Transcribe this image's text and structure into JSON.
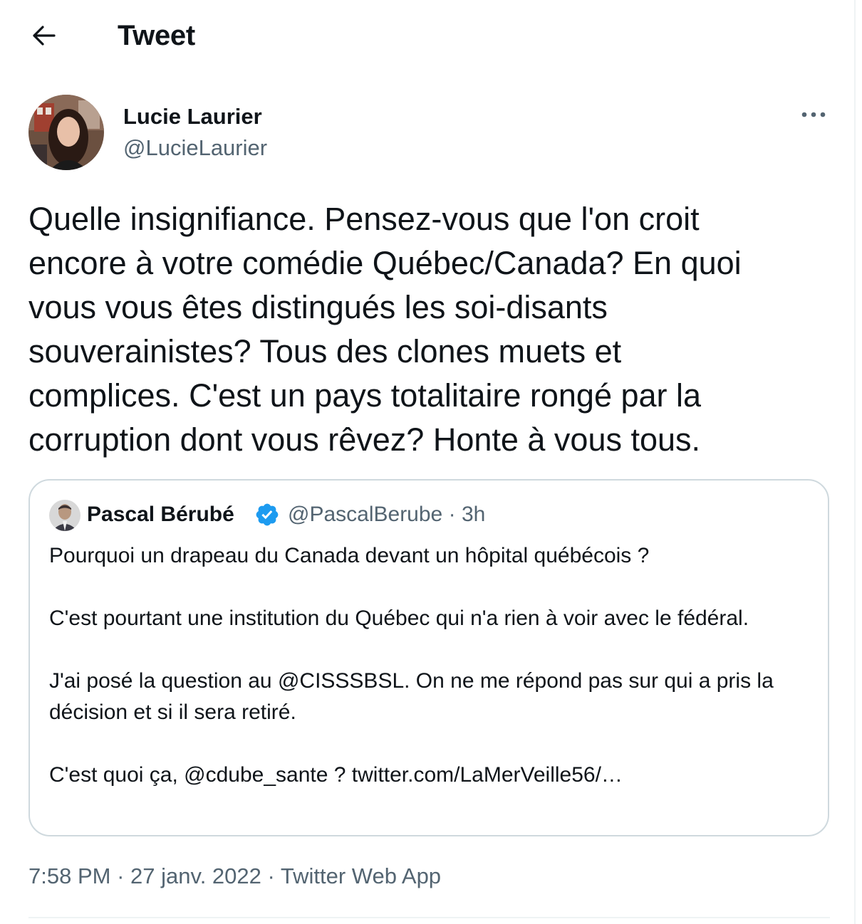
{
  "header": {
    "back_icon": "arrow-left-icon",
    "title": "Tweet"
  },
  "author": {
    "name": "Lucie Laurier",
    "handle": "@LucieLaurier",
    "more_icon": "more-horizontal-icon"
  },
  "tweet": {
    "text": "Quelle insignifiance. Pensez-vous que l'on croit\nencore à votre comédie Québec/Canada? En quoi\nvous vous êtes distingués les soi-disants\nsouverainistes? Tous des clones muets et\ncomplices. C'est un pays totalitaire rongé par la\ncorruption dont vous rêvez? Honte à vous tous."
  },
  "quoted_tweet": {
    "name": "Pascal Bérubé",
    "verified_icon": "verified-badge-icon",
    "handle": "@PascalBerube",
    "separator": "·",
    "time": "3h",
    "paragraphs": [
      "Pourquoi un drapeau du Canada devant un hôpital québécois ?",
      "C'est pourtant une institution du Québec qui n'a rien à voir avec le fédéral.",
      "J'ai posé la question au @CISSSBSL. On ne me répond pas sur qui a pris la décision et si il sera retiré.",
      "C'est quoi ça, @cdube_sante ? twitter.com/LaMerVeille56/…"
    ]
  },
  "footer": {
    "time": "7:58 PM",
    "date": "27 janv. 2022",
    "source": "Twitter Web App",
    "separator": "·"
  },
  "colors": {
    "text_primary": "#0f1419",
    "text_secondary": "#536471",
    "border": "#cfd9de",
    "verified_blue": "#1d9bf0"
  }
}
